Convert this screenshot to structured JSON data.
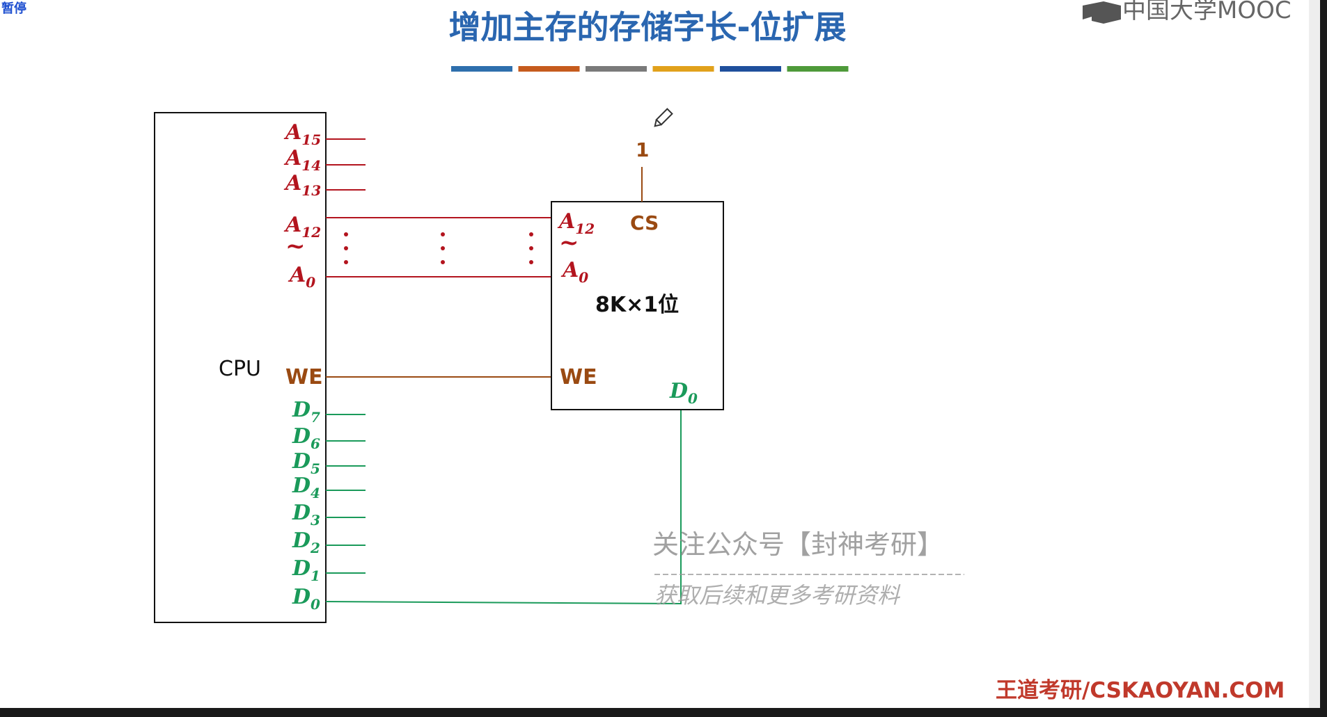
{
  "overlay": {
    "pause_label": "暂停",
    "mooc_brand": "中国大学MOOC"
  },
  "slide": {
    "title": "增加主存的存储字长-位扩展",
    "color_bar": [
      "#2e6fad",
      "#c65b1d",
      "#7a7a7a",
      "#e1a11b",
      "#1f4f9c",
      "#4e9a3a"
    ],
    "footer": "王道考研/CSKAOYAN.COM"
  },
  "cpu": {
    "label": "CPU",
    "address_pins": [
      {
        "name": "A",
        "sub": "15"
      },
      {
        "name": "A",
        "sub": "14"
      },
      {
        "name": "A",
        "sub": "13"
      },
      {
        "name": "A",
        "sub": "12"
      },
      {
        "name": "A",
        "sub": "0"
      }
    ],
    "range_symbol": "~",
    "we_label": "WE",
    "data_pins": [
      {
        "name": "D",
        "sub": "7"
      },
      {
        "name": "D",
        "sub": "6"
      },
      {
        "name": "D",
        "sub": "5"
      },
      {
        "name": "D",
        "sub": "4"
      },
      {
        "name": "D",
        "sub": "3"
      },
      {
        "name": "D",
        "sub": "2"
      },
      {
        "name": "D",
        "sub": "1"
      },
      {
        "name": "D",
        "sub": "0"
      }
    ]
  },
  "chip": {
    "label": "8K×1位",
    "cs_label": "CS",
    "cs_value": "1",
    "addr_top": {
      "name": "A",
      "sub": "12"
    },
    "addr_bottom": {
      "name": "A",
      "sub": "0"
    },
    "range_symbol": "~",
    "we_label": "WE",
    "data_out": {
      "name": "D",
      "sub": "0"
    }
  },
  "watermark": {
    "line1": "关注公众号【封神考研】",
    "line2": "获取后续和更多考研资料"
  },
  "colors": {
    "address": "#b3141e",
    "data": "#1a9a5a",
    "control": "#9a4a12",
    "title": "#2a66b0",
    "footer": "#c0392b"
  }
}
